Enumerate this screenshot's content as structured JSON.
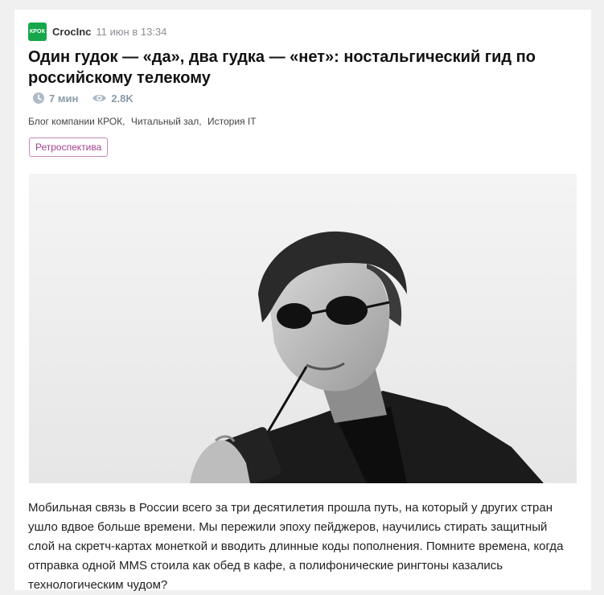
{
  "post": {
    "company_logo_text": "КРОК",
    "author": "CrocInc",
    "date": "11 июн в 13:34",
    "title": "Один гудок — «да», два гудка — «нет»: ностальгический гид по российскому телекому",
    "reading_time": "7 мин",
    "views": "2.8K",
    "hubs": [
      "Блог компании КРОК,",
      "Читальный зал,",
      "История IT"
    ],
    "tag": "Ретроспектива",
    "lead": "Мобильная связь в России всего за три десятилетия прошла путь, на который у других стран ушло вдвое больше времени. Мы пережили эпоху пейджеров, научились стирать защитный слой на скретч-картах монеткой и вводить длинные коды пополнения. Помните времена, когда отправка одной MMS стоила как обед в кафе, а полифонические рингтоны казались технологическим чудом?"
  },
  "colors": {
    "logo_bg": "#17a74b",
    "tag_color": "#a6428f",
    "page_bg": "#f0f0f0"
  },
  "icons": {
    "reading_time": "clock-icon",
    "views": "eye-icon"
  }
}
